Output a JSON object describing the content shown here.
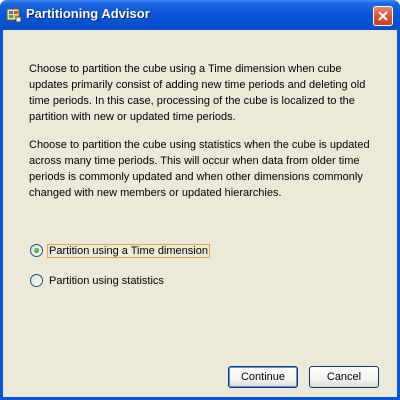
{
  "window": {
    "title": "Partitioning Advisor",
    "icon": "cube-app-icon",
    "close_icon": "close-icon"
  },
  "content": {
    "paragraph_1": "Choose to partition the cube using a Time dimension when cube updates primarily consist of adding new time periods and deleting old time periods. In this case, processing of the cube is localized to the partition with new or updated time periods.",
    "paragraph_2": "Choose to partition the cube using statistics when the cube is updated across many time periods. This will occur when data from older time periods is commonly updated and when other dimensions commonly changed with new members or updated hierarchies."
  },
  "options": [
    {
      "label": "Partition using a Time dimension",
      "selected": true
    },
    {
      "label": "Partition using statistics",
      "selected": false
    }
  ],
  "buttons": {
    "continue_label": "Continue",
    "cancel_label": "Cancel"
  },
  "colors": {
    "titlebar": "#0a56d8",
    "client_bg": "#ece9d8",
    "close_button": "#d9573a",
    "focus_border": "#e2a64a",
    "radio_dot": "#21a121"
  }
}
